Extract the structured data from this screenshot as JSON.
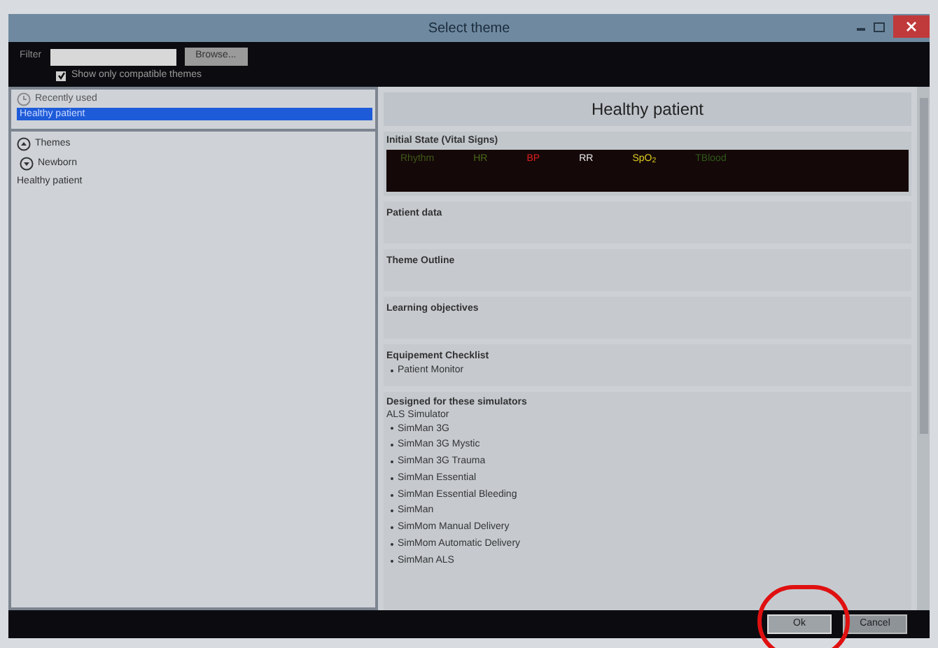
{
  "window": {
    "title": "Select theme"
  },
  "filter": {
    "label": "Filter",
    "button": "Browse...",
    "compatible_only": {
      "label": "Show only compatible themes",
      "checked": true
    }
  },
  "recently_used": {
    "title": "Recently used",
    "items": [
      {
        "label": "Healthy patient",
        "selected": true
      }
    ]
  },
  "themes": {
    "title": "Themes",
    "expanded": true,
    "groups": [
      {
        "title": "Newborn",
        "expanded": true,
        "items": [
          {
            "label": "Healthy patient",
            "selected": false
          }
        ]
      }
    ]
  },
  "detail": {
    "title": "Healthy patient",
    "vitals": {
      "title": "Initial State (Vital Signs)",
      "signs": [
        {
          "label": "Rhythm",
          "color": "#3f5a1a"
        },
        {
          "label": "HR",
          "color": "#4a6a1a"
        },
        {
          "label": "BP",
          "color": "#e02020"
        },
        {
          "label": "RR",
          "color": "#e8e8e8"
        },
        {
          "label": "SpO$_{2}$",
          "color": "#e0d020"
        },
        {
          "label": "TBlood",
          "color": "#2f5a1a"
        }
      ]
    },
    "sections": [
      {
        "title": "Patient data"
      },
      {
        "title": "Theme Outline"
      },
      {
        "title": "Learning objectives"
      },
      {
        "title": "Equipement Checklist",
        "items": [
          "Patient Monitor"
        ]
      }
    ],
    "simulators": {
      "title": "Designed for these simulators",
      "subtitle": "ALS Simulator",
      "items": [
        "SimMan 3G",
        "SimMan 3G Mystic",
        "SimMan 3G Trauma",
        "SimMan Essential",
        "SimMan Essential Bleeding",
        "SimMan",
        "SimMom Manual Delivery",
        "SimMom Automatic Delivery",
        "SimMan ALS"
      ]
    }
  },
  "buttons": [
    {
      "label": "Ok",
      "kind": "primary"
    },
    {
      "label": "Cancel",
      "kind": "secondary"
    }
  ]
}
